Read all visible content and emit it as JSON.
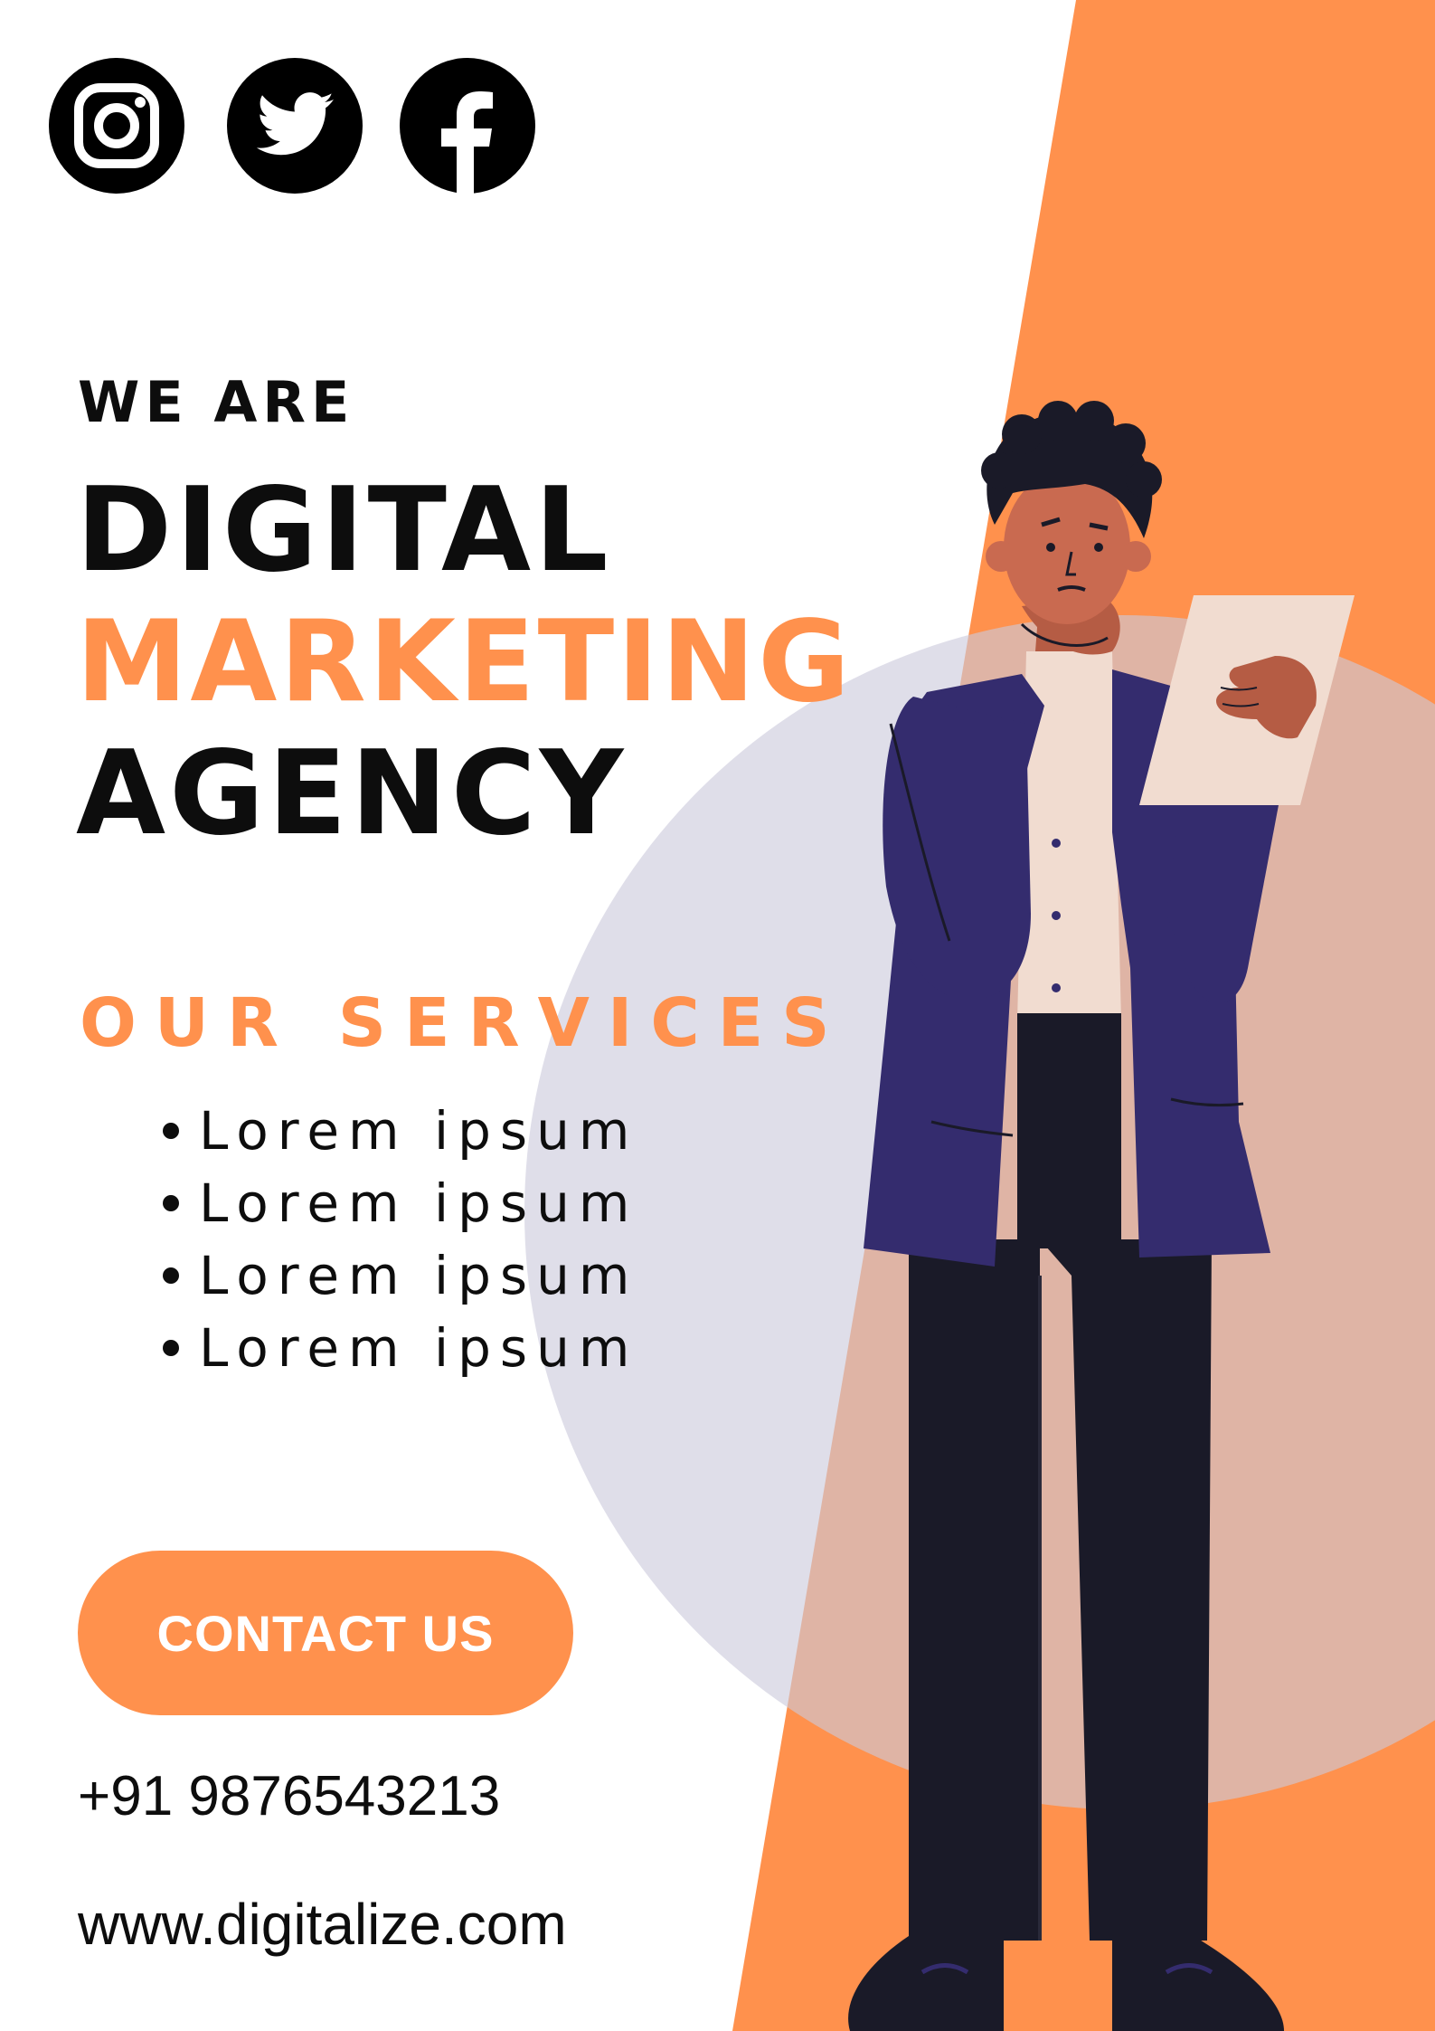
{
  "social": {
    "instagram_icon": "instagram-icon",
    "twitter_icon": "twitter-icon",
    "facebook_icon": "facebook-icon"
  },
  "headline": {
    "intro": "WE ARE",
    "line1": "DIGITAL",
    "line2": "MARKETING",
    "line3": "AGENCY"
  },
  "services": {
    "title": "OUR SERVICES",
    "items": [
      "Lorem ipsum",
      "Lorem ipsum",
      "Lorem ipsum",
      "Lorem ipsum"
    ]
  },
  "cta": {
    "label": "CONTACT US"
  },
  "contact": {
    "phone": "+91 9876543213",
    "website": "www.digitalize.com"
  },
  "colors": {
    "accent": "#ff914d",
    "text": "#0d0d0d",
    "circle": "#dfdde8",
    "jacket": "#342c6e",
    "pants": "#1a1a28",
    "skin": "#b55c44"
  }
}
